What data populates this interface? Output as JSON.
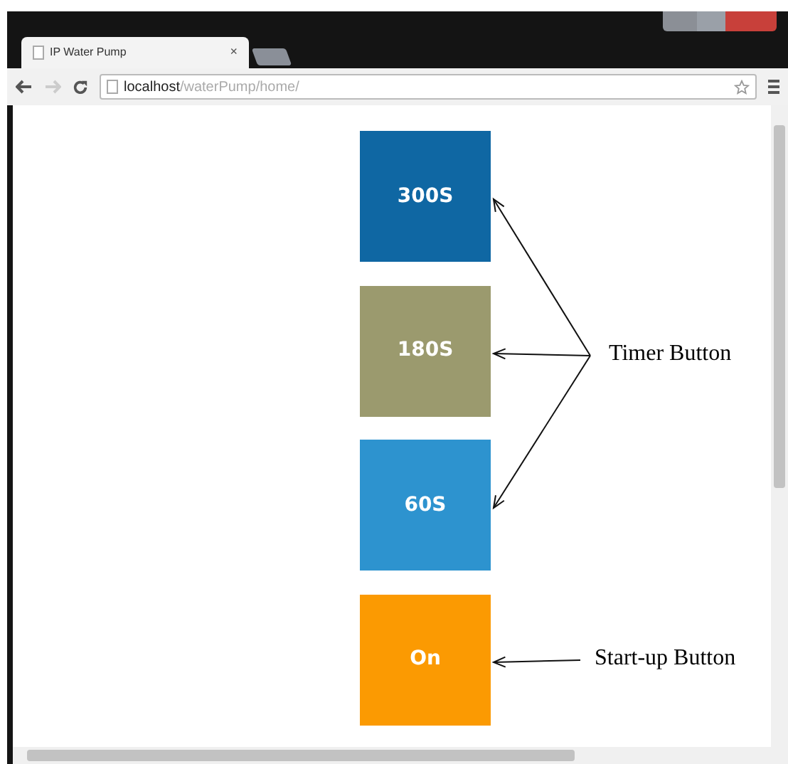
{
  "browser": {
    "tab": {
      "title": "IP Water Pump",
      "close": "×"
    },
    "address": {
      "host": "localhost",
      "path": "/waterPump/home/"
    }
  },
  "buttons": [
    {
      "label": "300S",
      "color": "#0f67a3",
      "kind": "timer"
    },
    {
      "label": "180S",
      "color": "#9b9a6e",
      "kind": "timer"
    },
    {
      "label": "60S",
      "color": "#2d93cf",
      "kind": "timer"
    },
    {
      "label": "On",
      "color": "#fb9a02",
      "kind": "startup"
    }
  ],
  "annotations": [
    {
      "label": "Timer Button",
      "kind": "timer"
    },
    {
      "label": "Start-up Button",
      "kind": "startup"
    }
  ]
}
